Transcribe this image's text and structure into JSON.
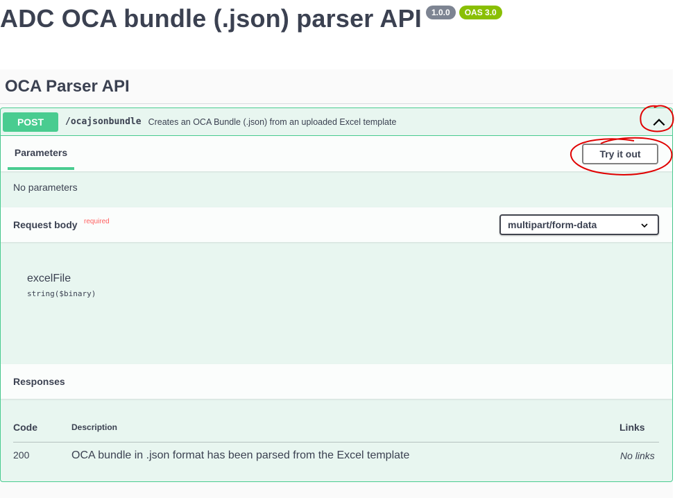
{
  "header": {
    "title": "ADC OCA bundle (.json) parser API",
    "version_badge": "1.0.0",
    "oas_badge": "OAS 3.0"
  },
  "tag": {
    "name": "OCA Parser API",
    "collapse_icon": "chevron-up-icon"
  },
  "operation": {
    "method": "POST",
    "path": "/ocajsonbundle",
    "summary": "Creates an OCA Bundle (.json) from an uploaded Excel template",
    "collapse_icon": "chevron-up-icon",
    "accent_color": "#49cc90",
    "background_color": "#e8f6f0"
  },
  "parameters": {
    "tab_label": "Parameters",
    "try_button": "Try it out",
    "empty_text": "No parameters"
  },
  "request_body": {
    "label": "Request body",
    "required_marker": "required",
    "content_type": "multipart/form-data",
    "field_name": "excelFile",
    "field_type": "string($binary)"
  },
  "responses": {
    "label": "Responses",
    "columns": {
      "code": "Code",
      "description": "Description",
      "links": "Links"
    },
    "rows": [
      {
        "code": "200",
        "description": "OCA bundle in .json format has been parsed from the Excel template",
        "links": "No links"
      }
    ]
  },
  "annotation_color": "#e00000"
}
